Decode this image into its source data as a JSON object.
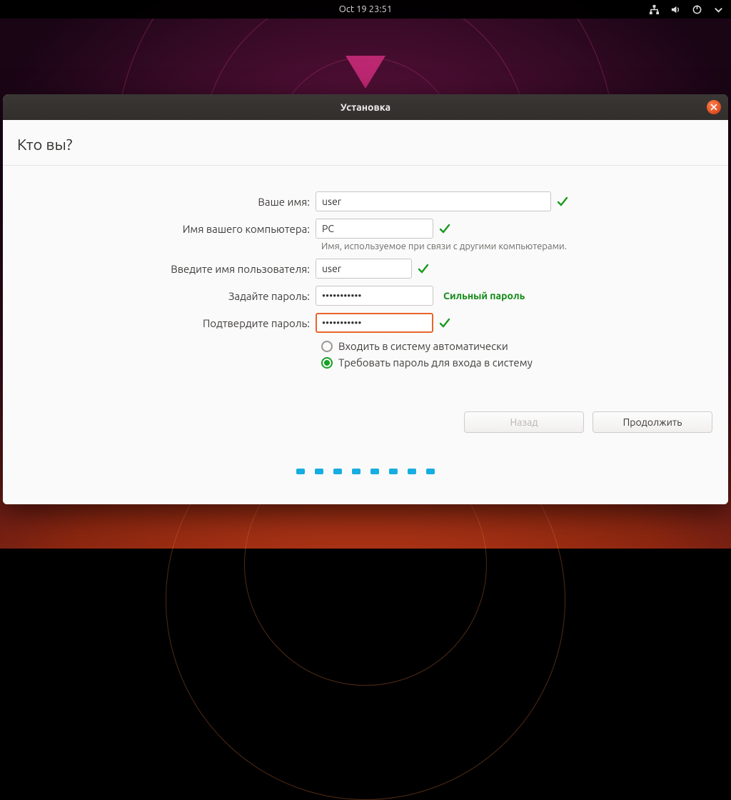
{
  "topbar": {
    "datetime": "Oct 19  23:51"
  },
  "window": {
    "title": "Установка",
    "page_title": "Кто вы?",
    "fields": {
      "name_label": "Ваше имя:",
      "name_value": "user",
      "host_label": "Имя вашего компьютера:",
      "host_value": "PC",
      "host_helper": "Имя, используемое при связи с другими компьютерами.",
      "user_label": "Введите имя пользователя:",
      "user_value": "user",
      "pass_label": "Задайте пароль:",
      "pass_value": "•••••••••••",
      "pass_strength": "Сильный пароль",
      "confirm_label": "Подтвердите пароль:",
      "confirm_value": "•••••••••••"
    },
    "login_options": {
      "auto_label": "Входить в систему автоматически",
      "require_label": "Требовать пароль для входа в систему",
      "selected": "require"
    },
    "buttons": {
      "back": "Назад",
      "continue": "Продолжить"
    },
    "progress_dots": 8
  }
}
